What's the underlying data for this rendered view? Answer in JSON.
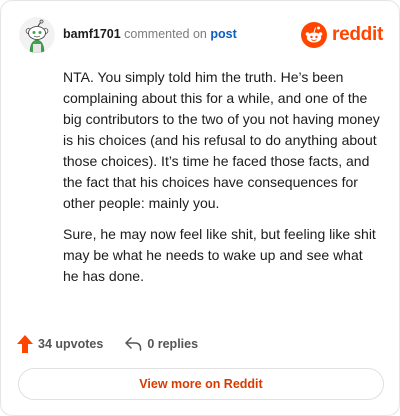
{
  "header": {
    "username": "bamf1701",
    "action_text": "commented on",
    "post_link": "post",
    "brand": "reddit"
  },
  "comment": {
    "paragraphs": [
      "NTA. You simply told him the truth. He’s been complaining about this for a while, and one of the big contributors to the two of you not having money is his choices (and his refusal to do anything about those choices). It’s time he faced those facts, and the fact that his choices have consequences for other people: mainly you.",
      "Sure, he may now feel like shit, but feeling like shit may be what he needs to wake up and see what he has done."
    ]
  },
  "actions": {
    "upvotes": "34 upvotes",
    "replies": "0 replies"
  },
  "footer": {
    "view_more": "View more on Reddit"
  },
  "colors": {
    "accent": "#ff4500",
    "link": "#0a5ec2",
    "view_more_text": "#d93a00"
  },
  "icons": {
    "avatar": "snoo-avatar-icon",
    "brand": "reddit-logo-icon",
    "upvote": "upvote-arrow-icon",
    "reply": "reply-icon"
  }
}
